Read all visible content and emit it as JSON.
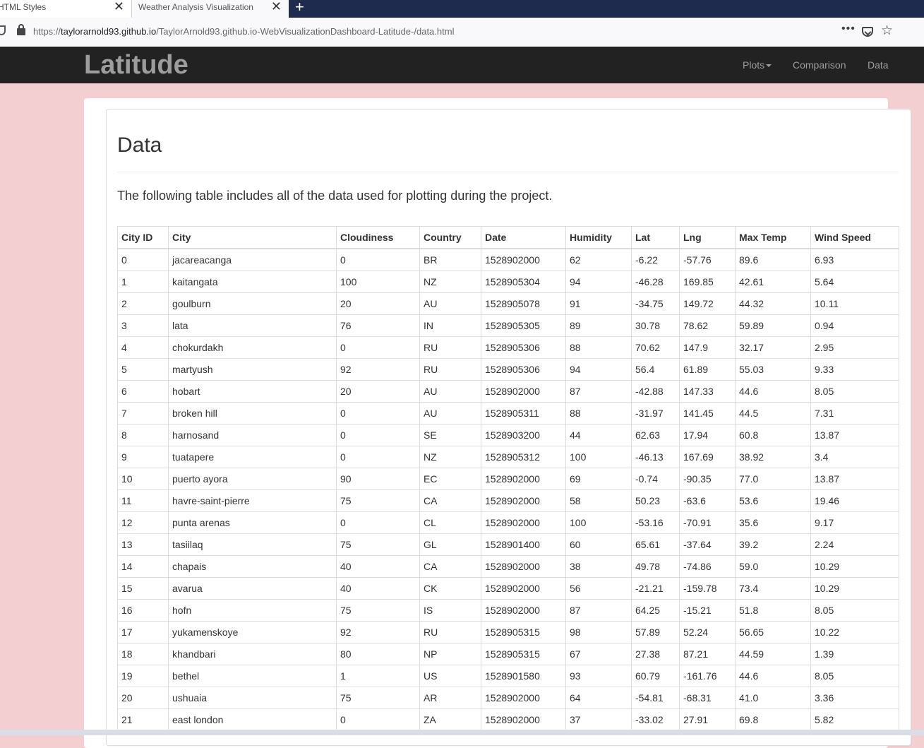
{
  "browser": {
    "tabs": [
      {
        "title": "HTML Styles",
        "active": false
      },
      {
        "title": "Weather Analysis Visualization",
        "active": true
      }
    ],
    "url_prefix": "https://",
    "url_host": "taylorarnold93.github.io",
    "url_path": "/TaylorArnold93.github.io-WebVisualizationDashboard-Latitude-/data.html",
    "more_label": "•••",
    "close_glyph": "✕",
    "new_tab_glyph": "+",
    "star_glyph": "☆"
  },
  "navbar": {
    "brand": "Latitude",
    "links": {
      "plots": "Plots",
      "comparison": "Comparison",
      "data": "Data"
    }
  },
  "page": {
    "title": "Data",
    "intro": "The following table includes all of the data used for plotting during the project."
  },
  "table": {
    "columns": [
      "City ID",
      "City",
      "Cloudiness",
      "Country",
      "Date",
      "Humidity",
      "Lat",
      "Lng",
      "Max Temp",
      "Wind Speed"
    ],
    "rows": [
      [
        "0",
        "jacareacanga",
        "0",
        "BR",
        "1528902000",
        "62",
        "-6.22",
        "-57.76",
        "89.6",
        "6.93"
      ],
      [
        "1",
        "kaitangata",
        "100",
        "NZ",
        "1528905304",
        "94",
        "-46.28",
        "169.85",
        "42.61",
        "5.64"
      ],
      [
        "2",
        "goulburn",
        "20",
        "AU",
        "1528905078",
        "91",
        "-34.75",
        "149.72",
        "44.32",
        "10.11"
      ],
      [
        "3",
        "lata",
        "76",
        "IN",
        "1528905305",
        "89",
        "30.78",
        "78.62",
        "59.89",
        "0.94"
      ],
      [
        "4",
        "chokurdakh",
        "0",
        "RU",
        "1528905306",
        "88",
        "70.62",
        "147.9",
        "32.17",
        "2.95"
      ],
      [
        "5",
        "martyush",
        "92",
        "RU",
        "1528905306",
        "94",
        "56.4",
        "61.89",
        "55.03",
        "9.33"
      ],
      [
        "6",
        "hobart",
        "20",
        "AU",
        "1528902000",
        "87",
        "-42.88",
        "147.33",
        "44.6",
        "8.05"
      ],
      [
        "7",
        "broken hill",
        "0",
        "AU",
        "1528905311",
        "88",
        "-31.97",
        "141.45",
        "44.5",
        "7.31"
      ],
      [
        "8",
        "harnosand",
        "0",
        "SE",
        "1528903200",
        "44",
        "62.63",
        "17.94",
        "60.8",
        "13.87"
      ],
      [
        "9",
        "tuatapere",
        "0",
        "NZ",
        "1528905312",
        "100",
        "-46.13",
        "167.69",
        "38.92",
        "3.4"
      ],
      [
        "10",
        "puerto ayora",
        "90",
        "EC",
        "1528902000",
        "69",
        "-0.74",
        "-90.35",
        "77.0",
        "13.87"
      ],
      [
        "11",
        "havre-saint-pierre",
        "75",
        "CA",
        "1528902000",
        "58",
        "50.23",
        "-63.6",
        "53.6",
        "19.46"
      ],
      [
        "12",
        "punta arenas",
        "0",
        "CL",
        "1528902000",
        "100",
        "-53.16",
        "-70.91",
        "35.6",
        "9.17"
      ],
      [
        "13",
        "tasiilaq",
        "75",
        "GL",
        "1528901400",
        "60",
        "65.61",
        "-37.64",
        "39.2",
        "2.24"
      ],
      [
        "14",
        "chapais",
        "40",
        "CA",
        "1528902000",
        "38",
        "49.78",
        "-74.86",
        "59.0",
        "10.29"
      ],
      [
        "15",
        "avarua",
        "40",
        "CK",
        "1528902000",
        "56",
        "-21.21",
        "-159.78",
        "73.4",
        "10.29"
      ],
      [
        "16",
        "hofn",
        "75",
        "IS",
        "1528902000",
        "87",
        "64.25",
        "-15.21",
        "51.8",
        "8.05"
      ],
      [
        "17",
        "yukamenskoye",
        "92",
        "RU",
        "1528905315",
        "98",
        "57.89",
        "52.24",
        "56.65",
        "10.22"
      ],
      [
        "18",
        "khandbari",
        "80",
        "NP",
        "1528905315",
        "67",
        "27.38",
        "87.21",
        "44.59",
        "1.39"
      ],
      [
        "19",
        "bethel",
        "1",
        "US",
        "1528901580",
        "93",
        "60.79",
        "-161.76",
        "44.6",
        "8.05"
      ],
      [
        "20",
        "ushuaia",
        "75",
        "AR",
        "1528902000",
        "64",
        "-54.81",
        "-68.31",
        "41.0",
        "3.36"
      ],
      [
        "21",
        "east london",
        "0",
        "ZA",
        "1528902000",
        "37",
        "-33.02",
        "27.91",
        "69.8",
        "5.82"
      ]
    ]
  }
}
